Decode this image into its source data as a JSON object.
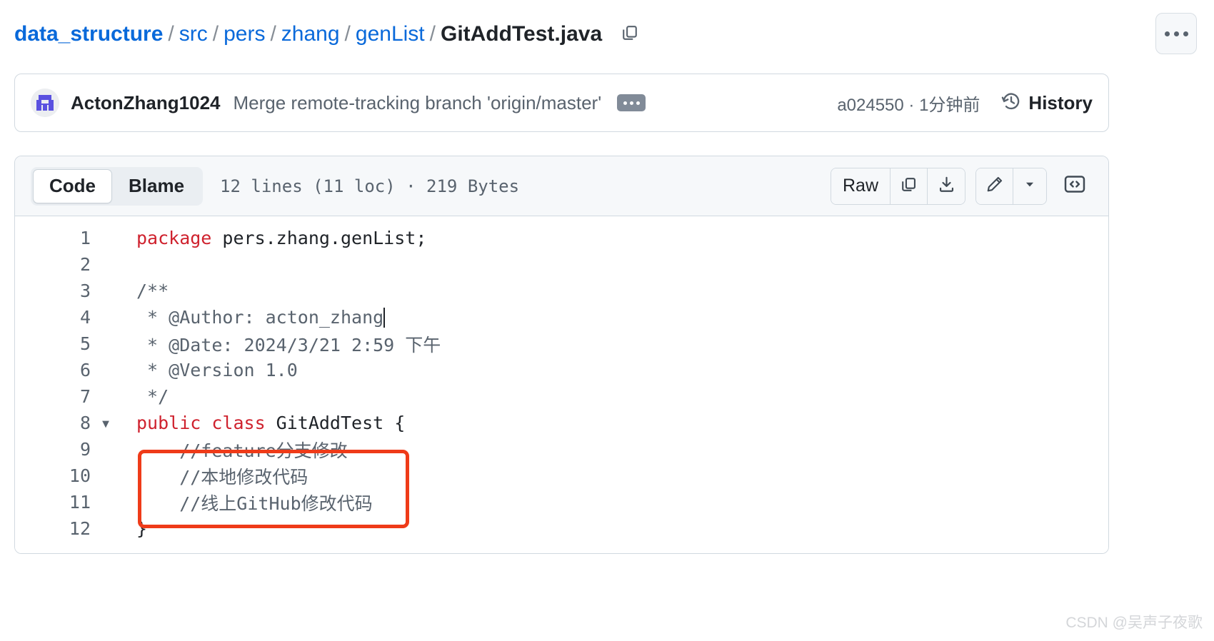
{
  "breadcrumb": {
    "repo": "data_structure",
    "separator": "/",
    "segments": [
      "src",
      "pers",
      "zhang",
      "genList"
    ],
    "current_file": "GitAddTest.java",
    "copy_path_icon": "copy-icon",
    "kebab_icon": "kebab-horizontal-icon"
  },
  "commit": {
    "author": "ActonZhang1024",
    "message": "Merge remote-tracking branch 'origin/master'",
    "expand_icon": "ellipsis-icon",
    "sha_and_time": "a024550 · 1分钟前",
    "history_label": "History",
    "history_icon": "history-clock-icon",
    "avatar_icon": "user-avatar-identicon"
  },
  "file_toolbar": {
    "tabs": [
      {
        "label": "Code",
        "active": true
      },
      {
        "label": "Blame",
        "active": false
      }
    ],
    "meta": "12 lines (11 loc) · 219 Bytes",
    "raw_label": "Raw",
    "copy_icon": "copy-raw-icon",
    "download_icon": "download-icon",
    "edit_icon": "pencil-icon",
    "edit_caret_icon": "chevron-down-icon",
    "symbols_icon": "code-brackets-icon"
  },
  "code": {
    "language": "java",
    "lines": [
      {
        "n": "1",
        "fold": "",
        "segments": [
          {
            "t": "package",
            "c": "kw"
          },
          {
            "t": " pers.zhang.genList;",
            "c": ""
          }
        ]
      },
      {
        "n": "2",
        "fold": "",
        "segments": [
          {
            "t": "",
            "c": ""
          }
        ]
      },
      {
        "n": "3",
        "fold": "",
        "segments": [
          {
            "t": "/**",
            "c": "cm"
          }
        ]
      },
      {
        "n": "4",
        "fold": "",
        "segments": [
          {
            "t": " * @Author: acton_zhang",
            "c": "cm"
          }
        ],
        "caret_after": true
      },
      {
        "n": "5",
        "fold": "",
        "segments": [
          {
            "t": " * @Date: 2024/3/21 2:59 下午",
            "c": "cm"
          }
        ]
      },
      {
        "n": "6",
        "fold": "",
        "segments": [
          {
            "t": " * @Version 1.0",
            "c": "cm"
          }
        ]
      },
      {
        "n": "7",
        "fold": "",
        "segments": [
          {
            "t": " */",
            "c": "cm"
          }
        ]
      },
      {
        "n": "8",
        "fold": "▾",
        "segments": [
          {
            "t": "public class",
            "c": "kw"
          },
          {
            "t": " GitAddTest {",
            "c": ""
          }
        ]
      },
      {
        "n": "9",
        "fold": "",
        "segments": [
          {
            "t": "    //feature分支修改",
            "c": "cm"
          }
        ]
      },
      {
        "n": "10",
        "fold": "",
        "segments": [
          {
            "t": "    //本地修改代码",
            "c": "cm"
          }
        ]
      },
      {
        "n": "11",
        "fold": "",
        "segments": [
          {
            "t": "    //线上GitHub修改代码",
            "c": "cm"
          }
        ]
      },
      {
        "n": "12",
        "fold": "",
        "segments": [
          {
            "t": "}",
            "c": ""
          }
        ]
      }
    ]
  },
  "annotation": {
    "shape": "rectangle",
    "color": "#ef3b19"
  },
  "watermark": {
    "text": "CSDN @吴声子夜歌"
  },
  "colors": {
    "link": "#0969da",
    "keyword": "#cf222e",
    "muted": "#59636e",
    "border": "#d1d9e0",
    "toolbar_bg": "#f6f8fa",
    "annotation": "#ef3b19"
  }
}
